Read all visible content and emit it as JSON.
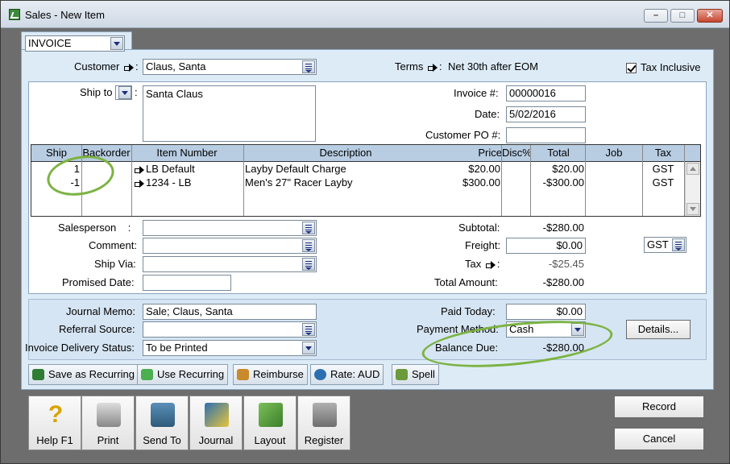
{
  "window": {
    "title": "Sales - New Item"
  },
  "form_type": {
    "value": "INVOICE"
  },
  "header": {
    "customer_label": "Customer",
    "customer_value": "Claus, Santa",
    "terms_label": "Terms",
    "terms_value": "Net 30th after EOM",
    "tax_inclusive_label": "Tax Inclusive",
    "tax_inclusive_checked": true
  },
  "ship_to": {
    "label": "Ship to",
    "address": "Santa Claus"
  },
  "invoice_info": {
    "invoice_no_label": "Invoice #:",
    "invoice_no": "00000016",
    "date_label": "Date:",
    "date": "5/02/2016",
    "customer_po_label": "Customer PO #:",
    "customer_po": ""
  },
  "grid": {
    "columns": [
      "Ship",
      "Backorder",
      "Item Number",
      "Description",
      "Price",
      "Disc%",
      "Total",
      "Job",
      "Tax"
    ],
    "rows": [
      {
        "ship": "1",
        "backorder": "",
        "item": "LB Default",
        "description": "Layby Default Charge",
        "price": "$20.00",
        "disc": "",
        "total": "$20.00",
        "job": "",
        "tax": "GST"
      },
      {
        "ship": "-1",
        "backorder": "",
        "item": "1234 - LB",
        "description": "Men's 27\" Racer Layby",
        "price": "$300.00",
        "disc": "",
        "total": "-$300.00",
        "job": "",
        "tax": "GST"
      }
    ]
  },
  "details": {
    "salesperson_label": "Salesperson",
    "salesperson": "",
    "comment_label": "Comment:",
    "comment": "",
    "ship_via_label": "Ship Via:",
    "ship_via": "",
    "promised_date_label": "Promised Date:",
    "promised_date": ""
  },
  "totals": {
    "subtotal_label": "Subtotal:",
    "subtotal": "-$280.00",
    "freight_label": "Freight:",
    "freight": "$0.00",
    "freight_tax": "GST",
    "tax_label": "Tax",
    "tax": "-$25.45",
    "total_label": "Total Amount:",
    "total": "-$280.00"
  },
  "payment": {
    "journal_memo_label": "Journal Memo:",
    "journal_memo": "Sale; Claus, Santa",
    "referral_label": "Referral Source:",
    "referral": "",
    "delivery_label": "Invoice Delivery Status:",
    "delivery": "To be Printed",
    "paid_today_label": "Paid Today:",
    "paid_today": "$0.00",
    "payment_method_label": "Payment Method:",
    "payment_method": "Cash",
    "balance_due_label": "Balance Due:",
    "balance_due": "-$280.00",
    "details_button": "Details..."
  },
  "toolbar": {
    "save_recurring": "Save as Recurring",
    "use_recurring": "Use Recurring",
    "reimburse": "Reimburse",
    "rate": "Rate:  AUD",
    "spell": "Spell"
  },
  "bottom_buttons": {
    "help": "Help F1",
    "print": "Print",
    "send_to": "Send To",
    "journal": "Journal",
    "layout": "Layout",
    "register": "Register",
    "record": "Record",
    "cancel": "Cancel"
  },
  "colors": {
    "panel": "#ddebf7",
    "annotation": "#7cb342"
  }
}
